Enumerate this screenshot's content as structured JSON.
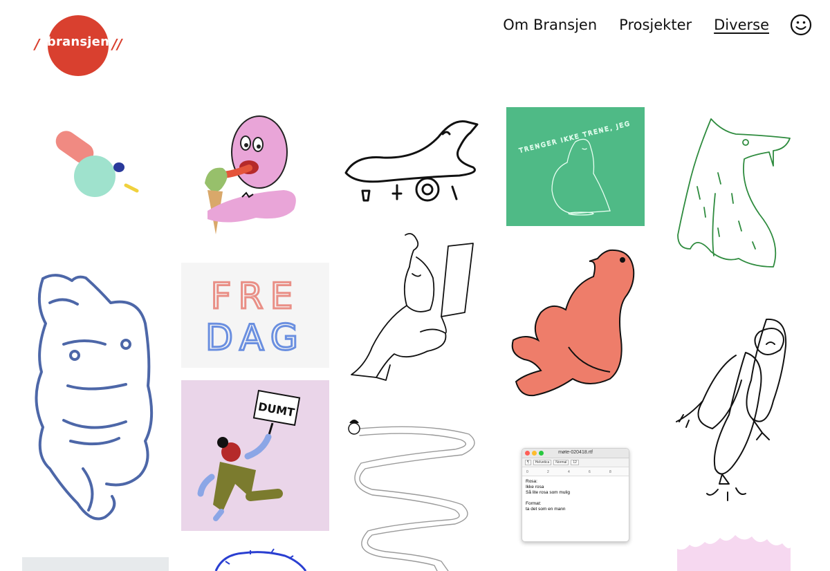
{
  "logo": {
    "text": "bransjen",
    "slash_left": "/",
    "slash_right": "//",
    "color": "#d9402f"
  },
  "nav": {
    "items": [
      {
        "label": "Om Bransjen",
        "active": false
      },
      {
        "label": "Prosjekter",
        "active": false
      },
      {
        "label": "Diverse",
        "active": true
      }
    ],
    "smiley_icon": "smiley-icon"
  },
  "gallery": {
    "fredag": {
      "line1": "FRE",
      "line2": "DAG"
    },
    "dumt_sign": "DUMT",
    "green_card": "TRENGER IKKE TRENE, JEG",
    "mac_window": {
      "title": "møte-020418.rtf",
      "toolbar": [
        "¶",
        "Helvetica",
        "Normal",
        "12"
      ],
      "ruler": [
        "0",
        "2",
        "4",
        "6",
        "8"
      ],
      "lines": [
        "Rosa:",
        "Ikke rosa",
        "Så lite rosa som mulig",
        "",
        "Format:",
        "ta det som en mann"
      ]
    }
  },
  "colors": {
    "accent": "#d9402f",
    "green_card": "#4fba86",
    "pink_card": "#ead5e9",
    "salmon": "#ee7d6a",
    "blue_sketch": "#4d67a8"
  }
}
